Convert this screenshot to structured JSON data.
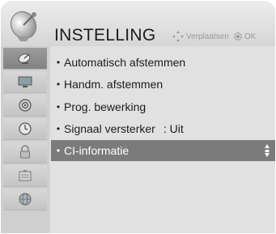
{
  "header": {
    "title": "INSTELLING",
    "logo_icon": "satellite-dish-icon",
    "hint_move": "Verplaatsen",
    "hint_ok": "OK"
  },
  "sidebar": {
    "items": [
      {
        "icon": "satellite-dish-icon",
        "active": true
      },
      {
        "icon": "tv-picture-icon",
        "active": false
      },
      {
        "icon": "speaker-icon",
        "active": false
      },
      {
        "icon": "clock-icon",
        "active": false
      },
      {
        "icon": "lock-icon",
        "active": false
      },
      {
        "icon": "option-box-icon",
        "active": false
      },
      {
        "icon": "network-globe-icon",
        "active": false
      }
    ]
  },
  "menu": {
    "items": [
      {
        "label": "Automatisch afstemmen",
        "value": "",
        "selected": false
      },
      {
        "label": "Handm. afstemmen",
        "value": "",
        "selected": false
      },
      {
        "label": "Prog. bewerking",
        "value": "",
        "selected": false
      },
      {
        "label": "Signaal versterker",
        "value": ": Uit",
        "selected": false
      },
      {
        "label": "CI-informatie",
        "value": "",
        "selected": true
      }
    ]
  },
  "colors": {
    "selected_row": "#7b7b7b",
    "active_sidebar": "#8e8e8e",
    "panel": "#dcdcdc"
  }
}
